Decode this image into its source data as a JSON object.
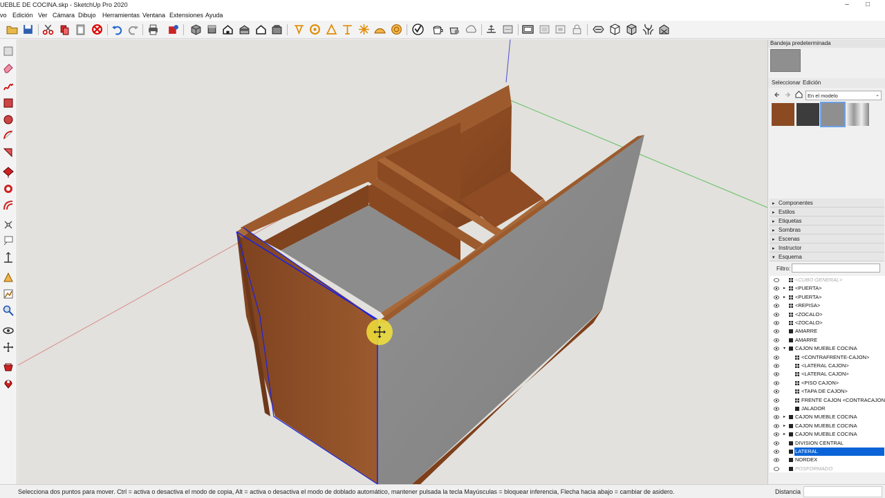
{
  "window": {
    "title": "UEBLE DE COCINA.skp - SketchUp Pro 2020",
    "minimize": "–",
    "maximize": "□"
  },
  "menu": [
    "vo",
    "Edición",
    "Ver",
    "Cámara",
    "Dibujo",
    "Herramientas",
    "Ventana",
    "Extensiones",
    "Ayuda"
  ],
  "toolbar_icons": [
    "open-icon",
    "save-icon",
    "cut-icon",
    "copy-icon",
    "paste-icon",
    "erase-icon",
    "undo-icon",
    "redo-icon",
    "print-icon",
    "model-info-icon",
    "iso-view-icon",
    "top-view-icon",
    "front-view-icon",
    "right-view-icon",
    "back-view-icon",
    "left-view-icon",
    "dimension-icon",
    "protractor-icon",
    "text-icon",
    "axes-icon",
    "3d-text-icon",
    "section-icon",
    "paint-icon",
    "xray-icon",
    "backedges-icon",
    "wireframe-icon",
    "hiddenline-icon",
    "shaded-icon",
    "textured-icon",
    "monochrome-icon",
    "sandbox-icon",
    "stamp-icon",
    "drape-icon",
    "smoove-icon",
    "flip-icon"
  ],
  "left_tools": [
    "select-icon",
    "eraser-icon",
    "freehand-icon",
    "rectangle-icon",
    "circle-icon",
    "arc-icon",
    "polygon-icon",
    "pushpull-icon",
    "followme-icon",
    "offset-icon",
    "move-icon",
    "text-icon",
    "dimension-icon",
    "tape-icon",
    "protractor-icon",
    "orbit-icon",
    "pan-icon",
    "zoom-icon",
    "zoom-extents-icon",
    "walk-icon"
  ],
  "tray": {
    "title": "Bandeja predeterminada",
    "tabs": [
      "Seleccionar",
      "Edición"
    ],
    "library": "En el modelo",
    "materials": [
      {
        "name": "wood-material",
        "color": "#8b4a22"
      },
      {
        "name": "dark-granite-material",
        "color": "#3c3c3c"
      },
      {
        "name": "gray-material",
        "color": "#8f8f8f"
      },
      {
        "name": "steel-material",
        "color": "#c9c9c9"
      }
    ],
    "panels": [
      {
        "label": "Componentes",
        "expanded": false
      },
      {
        "label": "Estilos",
        "expanded": false
      },
      {
        "label": "Etiquetas",
        "expanded": false
      },
      {
        "label": "Sombras",
        "expanded": false
      },
      {
        "label": "Escenas",
        "expanded": false
      },
      {
        "label": "Instructor",
        "expanded": false
      },
      {
        "label": "Esquema",
        "expanded": true
      }
    ],
    "filter_label": "Filtro:",
    "outliner": [
      {
        "label": "<CUBO GENERAL>",
        "indent": 0,
        "expand": "",
        "type": "component",
        "hidden": true
      },
      {
        "label": "<PUERTA>",
        "indent": 0,
        "expand": "▸",
        "type": "component"
      },
      {
        "label": "<PUERTA>",
        "indent": 0,
        "expand": "▸",
        "type": "component"
      },
      {
        "label": "<REPISA>",
        "indent": 0,
        "expand": "",
        "type": "component"
      },
      {
        "label": "<ZOCALO>",
        "indent": 0,
        "expand": "",
        "type": "component"
      },
      {
        "label": "<ZOCALO>",
        "indent": 0,
        "expand": "",
        "type": "component"
      },
      {
        "label": "AMARRE",
        "indent": 0,
        "expand": "",
        "type": "group"
      },
      {
        "label": "AMARRE",
        "indent": 0,
        "expand": "",
        "type": "group"
      },
      {
        "label": "CAJON MUEBLE COCINA",
        "indent": 0,
        "expand": "▾",
        "type": "group"
      },
      {
        "label": "<CONTRAFRENTE-CAJON>",
        "indent": 1,
        "expand": "",
        "type": "component"
      },
      {
        "label": "<LATERAL CAJON>",
        "indent": 1,
        "expand": "",
        "type": "component"
      },
      {
        "label": "<LATERAL CAJON>",
        "indent": 1,
        "expand": "",
        "type": "component"
      },
      {
        "label": "<PISO CAJON>",
        "indent": 1,
        "expand": "",
        "type": "component"
      },
      {
        "label": "<TAPA DE CAJON>",
        "indent": 1,
        "expand": "",
        "type": "component"
      },
      {
        "label": "FRENTE CAJON <CONTRACAJON>",
        "indent": 1,
        "expand": "",
        "type": "component"
      },
      {
        "label": "JALADOR",
        "indent": 1,
        "expand": "",
        "type": "group"
      },
      {
        "label": "CAJON MUEBLE COCINA",
        "indent": 0,
        "expand": "▸",
        "type": "group"
      },
      {
        "label": "CAJON MUEBLE COCINA",
        "indent": 0,
        "expand": "▸",
        "type": "group"
      },
      {
        "label": "CAJON MUEBLE COCINA",
        "indent": 0,
        "expand": "▸",
        "type": "group"
      },
      {
        "label": "DIVISION CENTRAL",
        "indent": 0,
        "expand": "",
        "type": "group"
      },
      {
        "label": "LATERAL",
        "indent": 0,
        "expand": "",
        "type": "group",
        "selected": true
      },
      {
        "label": "NORDEX",
        "indent": 0,
        "expand": "",
        "type": "group"
      },
      {
        "label": "POSFORMADO",
        "indent": 0,
        "expand": "",
        "type": "group",
        "hidden": true
      }
    ]
  },
  "status": {
    "hint": "Selecciona dos puntos para mover. Ctrl = activa o desactiva el modo de copia, Alt = activa o desactiva el modo de doblado automático, mantener pulsada la tecla Mayúsculas = bloquear inferencia, Flecha hacia abajo = cambiar de asidero.",
    "measure_label": "Distancia",
    "measure_value": ""
  },
  "colors": {
    "wood": "#8b4a22",
    "panel_gray": "#8e8e8e",
    "selection_blue": "#1a22e6",
    "cursor_highlight": "#f2e23a",
    "background": "#e2e1dd"
  }
}
